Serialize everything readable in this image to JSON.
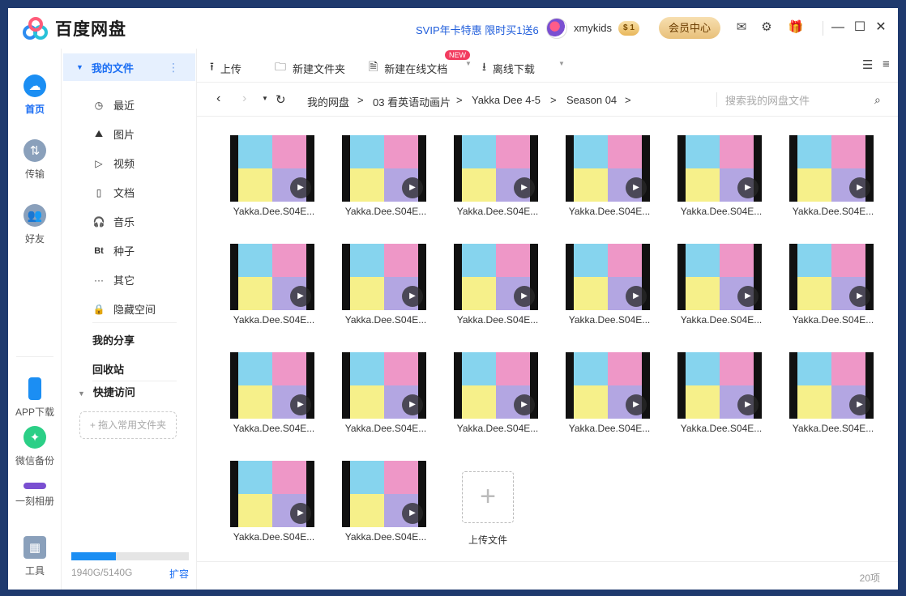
{
  "app": {
    "title": "百度网盘"
  },
  "promo": "SVIP年卡特惠 限时买1送6",
  "user": {
    "name": "xmykids",
    "badge": "$ 1"
  },
  "member_center": "会员中心",
  "rail": [
    {
      "label": "首页",
      "icon": "home-cloud-icon",
      "color": "#1b8ef3",
      "active": true
    },
    {
      "label": "传输",
      "icon": "transfer-icon",
      "color": "#8aa0bb"
    },
    {
      "label": "好友",
      "icon": "friends-icon",
      "color": "#8aa0bb"
    },
    {
      "label": "APP下载",
      "icon": "phone-icon",
      "color": "#1b8ef3"
    },
    {
      "label": "微信备份",
      "icon": "wechat-backup-icon",
      "color": "#2bcf86"
    },
    {
      "label": "一刻相册",
      "icon": "album-icon",
      "color": "#7a4fd1"
    },
    {
      "label": "工具",
      "icon": "tools-icon",
      "color": "#8aa0bb"
    }
  ],
  "nav": {
    "my_files": "我的文件",
    "subs": [
      {
        "label": "最近",
        "icon": "clock-icon",
        "glyph": "◷"
      },
      {
        "label": "图片",
        "icon": "image-icon",
        "glyph": "⛰"
      },
      {
        "label": "视频",
        "icon": "video-icon",
        "glyph": "▷"
      },
      {
        "label": "文档",
        "icon": "document-icon",
        "glyph": "▯"
      },
      {
        "label": "音乐",
        "icon": "headphones-icon",
        "glyph": "🎧"
      },
      {
        "label": "种子",
        "icon": "bt-icon",
        "glyph": "Bt"
      },
      {
        "label": "其它",
        "icon": "more-icon",
        "glyph": "···"
      },
      {
        "label": "隐藏空间",
        "icon": "lock-icon",
        "glyph": "🔒"
      }
    ],
    "my_share": "我的分享",
    "recycle": "回收站",
    "quick_access": "快捷访问",
    "drop_hint": "+ 拖入常用文件夹",
    "storage": {
      "used_fraction": 0.3774,
      "text": "1940G/5140G",
      "expand": "扩容"
    }
  },
  "toolbar": {
    "upload": "上传",
    "new_folder": "新建文件夹",
    "new_doc": "新建在线文档",
    "new_badge": "NEW",
    "offline": "离线下载"
  },
  "path": {
    "crumbs": [
      "我的网盘",
      "03 看英语动画片",
      "Yakka Dee 4-5",
      "Season 04"
    ],
    "search_placeholder": "搜索我的网盘文件"
  },
  "files": [
    {
      "name": "Yakka.Dee.S04E..."
    },
    {
      "name": "Yakka.Dee.S04E..."
    },
    {
      "name": "Yakka.Dee.S04E..."
    },
    {
      "name": "Yakka.Dee.S04E..."
    },
    {
      "name": "Yakka.Dee.S04E..."
    },
    {
      "name": "Yakka.Dee.S04E..."
    },
    {
      "name": "Yakka.Dee.S04E..."
    },
    {
      "name": "Yakka.Dee.S04E..."
    },
    {
      "name": "Yakka.Dee.S04E..."
    },
    {
      "name": "Yakka.Dee.S04E..."
    },
    {
      "name": "Yakka.Dee.S04E..."
    },
    {
      "name": "Yakka.Dee.S04E..."
    },
    {
      "name": "Yakka.Dee.S04E..."
    },
    {
      "name": "Yakka.Dee.S04E..."
    },
    {
      "name": "Yakka.Dee.S04E..."
    },
    {
      "name": "Yakka.Dee.S04E..."
    },
    {
      "name": "Yakka.Dee.S04E..."
    },
    {
      "name": "Yakka.Dee.S04E..."
    },
    {
      "name": "Yakka.Dee.S04E..."
    },
    {
      "name": "Yakka.Dee.S04E..."
    }
  ],
  "upload_tile": "上传文件",
  "item_count": "20项"
}
